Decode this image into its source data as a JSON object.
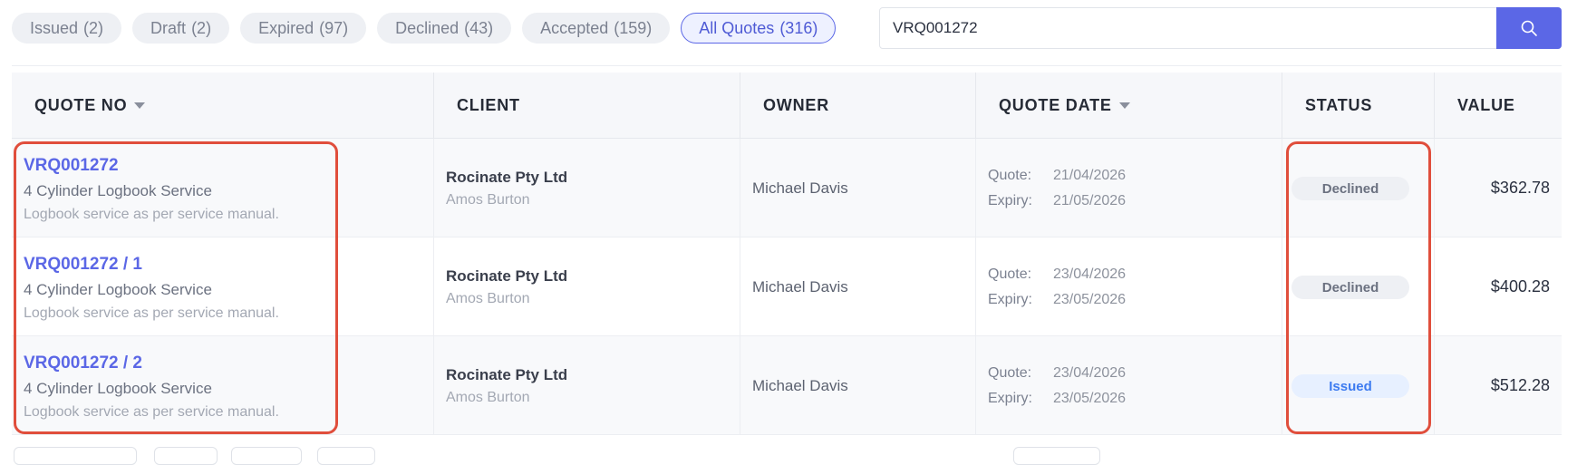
{
  "filters": [
    {
      "label": "Issued",
      "count": "(2)",
      "active": false
    },
    {
      "label": "Draft",
      "count": "(2)",
      "active": false
    },
    {
      "label": "Expired",
      "count": "(97)",
      "active": false
    },
    {
      "label": "Declined",
      "count": "(43)",
      "active": false
    },
    {
      "label": "Accepted",
      "count": "(159)",
      "active": false
    },
    {
      "label": "All Quotes",
      "count": "(316)",
      "active": true
    }
  ],
  "search": {
    "value": "VRQ001272",
    "button_icon": "search-icon"
  },
  "table": {
    "columns": [
      "QUOTE NO",
      "CLIENT",
      "OWNER",
      "QUOTE DATE",
      "STATUS",
      "VALUE"
    ],
    "rows": [
      {
        "quote_no": "VRQ001272",
        "title": "4 Cylinder Logbook Service",
        "description": "Logbook service as per service manual.",
        "client": "Rocinate Pty Ltd",
        "contact": "Amos Burton",
        "owner": "Michael Davis",
        "quote_label": "Quote:",
        "quote_date": "21/04/2026",
        "expiry_label": "Expiry:",
        "expiry_date": "21/05/2026",
        "status": "Declined",
        "value": "$362.78"
      },
      {
        "quote_no": "VRQ001272 / 1",
        "title": "4 Cylinder Logbook Service",
        "description": "Logbook service as per service manual.",
        "client": "Rocinate Pty Ltd",
        "contact": "Amos Burton",
        "owner": "Michael Davis",
        "quote_label": "Quote:",
        "quote_date": "23/04/2026",
        "expiry_label": "Expiry:",
        "expiry_date": "23/05/2026",
        "status": "Declined",
        "value": "$400.28"
      },
      {
        "quote_no": "VRQ001272 / 2",
        "title": "4 Cylinder Logbook Service",
        "description": "Logbook service as per service manual.",
        "client": "Rocinate Pty Ltd",
        "contact": "Amos Burton",
        "owner": "Michael Davis",
        "quote_label": "Quote:",
        "quote_date": "23/04/2026",
        "expiry_label": "Expiry:",
        "expiry_date": "23/05/2026",
        "status": "Issued",
        "value": "$512.28"
      }
    ]
  },
  "colors": {
    "accent": "#5b67e6",
    "highlight": "#e04e3c",
    "issued": "#3d7bf0"
  }
}
